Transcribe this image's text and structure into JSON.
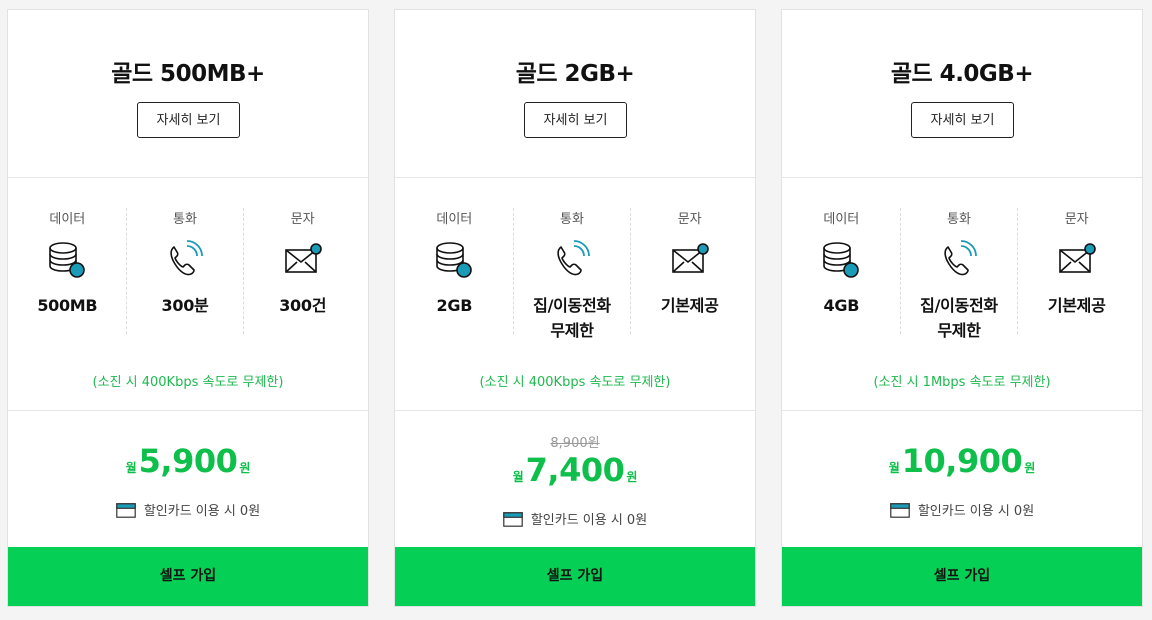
{
  "plans": [
    {
      "title": "골드 500MB+",
      "detail_label": "자세히 보기",
      "features": [
        {
          "label": "데이터",
          "icon": "database-icon",
          "value": "500MB"
        },
        {
          "label": "통화",
          "icon": "phone-icon",
          "value": "300분"
        },
        {
          "label": "문자",
          "icon": "mail-icon",
          "value": "300건"
        }
      ],
      "note": "(소진 시 400Kbps 속도로 무제한)",
      "original_price": "",
      "price_prefix": "월",
      "price": "5,900",
      "price_suffix": "원",
      "discount_text": "할인카드 이용 시 0원",
      "join_label": "셀프 가입"
    },
    {
      "title": "골드 2GB+",
      "detail_label": "자세히 보기",
      "features": [
        {
          "label": "데이터",
          "icon": "database-icon",
          "value": "2GB"
        },
        {
          "label": "통화",
          "icon": "phone-icon",
          "value": "집/이동전화\n무제한"
        },
        {
          "label": "문자",
          "icon": "mail-icon",
          "value": "기본제공"
        }
      ],
      "note": "(소진 시 400Kbps 속도로 무제한)",
      "original_price": "8,900원",
      "price_prefix": "월",
      "price": "7,400",
      "price_suffix": "원",
      "discount_text": "할인카드 이용 시 0원",
      "join_label": "셀프 가입"
    },
    {
      "title": "골드 4.0GB+",
      "detail_label": "자세히 보기",
      "features": [
        {
          "label": "데이터",
          "icon": "database-icon",
          "value": "4GB"
        },
        {
          "label": "통화",
          "icon": "phone-icon",
          "value": "집/이동전화\n무제한"
        },
        {
          "label": "문자",
          "icon": "mail-icon",
          "value": "기본제공"
        }
      ],
      "note": "(소진 시 1Mbps 속도로 무제한)",
      "original_price": "",
      "price_prefix": "월",
      "price": "10,900",
      "price_suffix": "원",
      "discount_text": "할인카드 이용 시 0원",
      "join_label": "셀프 가입"
    }
  ],
  "colors": {
    "accent_green": "#06cf55",
    "price_green": "#0ec04b",
    "note_green": "#1fb84f",
    "icon_teal": "#1a9bb8"
  }
}
